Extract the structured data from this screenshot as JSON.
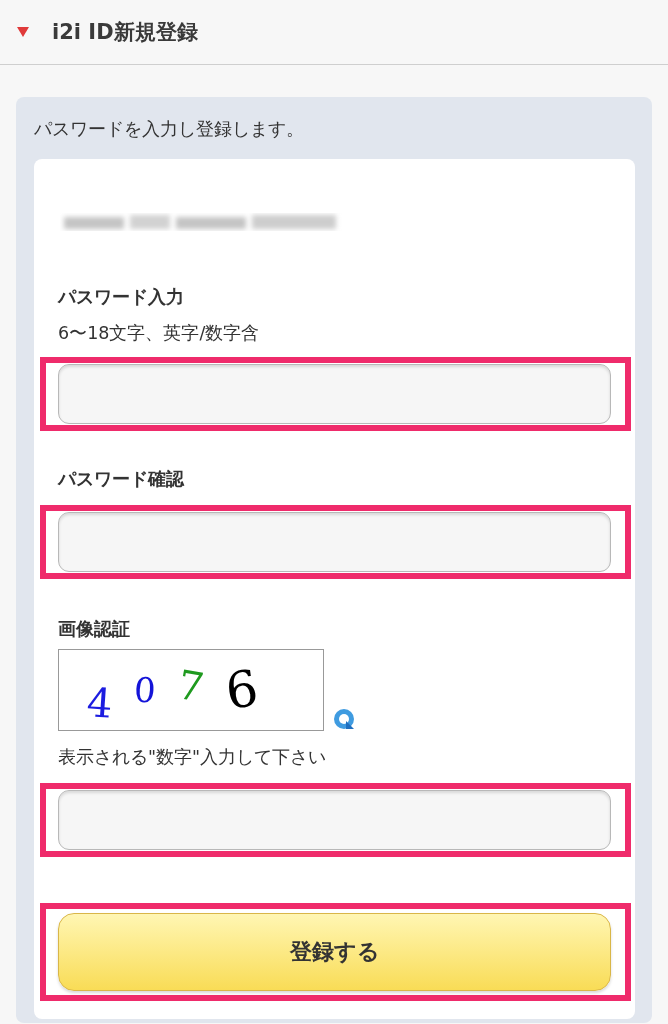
{
  "header": {
    "title": "i2i ID新規登録"
  },
  "intro": "パスワードを入力し登録します。",
  "email": {
    "redacted": true
  },
  "fields": [
    {
      "label": "パスワード入力",
      "hint": "6〜18文字、英字/数字含",
      "highlighted": true
    },
    {
      "label": "パスワード確認",
      "highlighted": true
    }
  ],
  "captcha": {
    "label": "画像認証",
    "digits": [
      {
        "text": "4",
        "color": "#1c1ce0"
      },
      {
        "text": "0",
        "color": "#1414d8"
      },
      {
        "text": "7",
        "color": "#1f9a1f"
      },
      {
        "text": "6",
        "color": "#000000"
      }
    ],
    "hint": "表示される\"数字\"入力して下さい",
    "highlighted": true
  },
  "submit": {
    "label": "登録する",
    "highlighted": true
  }
}
